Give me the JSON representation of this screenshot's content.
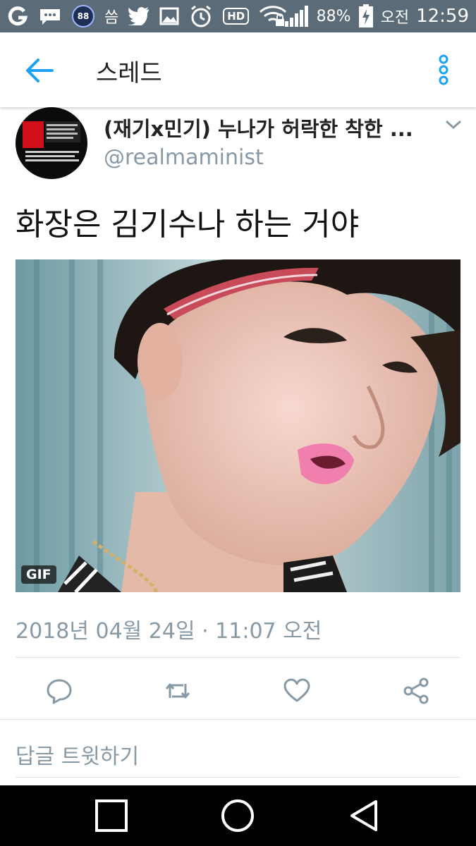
{
  "status_bar": {
    "left_icons": [
      "carrier-g-icon",
      "messages-icon",
      "badge-88-icon",
      "korean-app-icon",
      "twitter-icon",
      "gallery-icon",
      "alarm-icon",
      "hd-icon",
      "wifi-icon"
    ],
    "badge_label": "88",
    "korean_app_label": "씀",
    "hd_label": "HD",
    "battery": "88%",
    "ampm": "오전",
    "time": "12:59"
  },
  "app_bar": {
    "title": "스레드"
  },
  "tweet": {
    "display_name": "(재기x민기) 누나가 허락한 착한 ...",
    "handle": "@realmaminist",
    "text": "화장은 김기수나 하는 거야",
    "media_badge": "GIF",
    "timestamp": "2018년 04월 24일 · 11:07 오전"
  },
  "actions": [
    "reply-icon",
    "retweet-icon",
    "like-icon",
    "share-icon"
  ],
  "reply_prompt": "답글 트윗하기",
  "colors": {
    "status_bar": "#5c6b78",
    "accent": "#1da1f2",
    "muted_text": "#8899a6",
    "nav_bar": "#000000"
  }
}
